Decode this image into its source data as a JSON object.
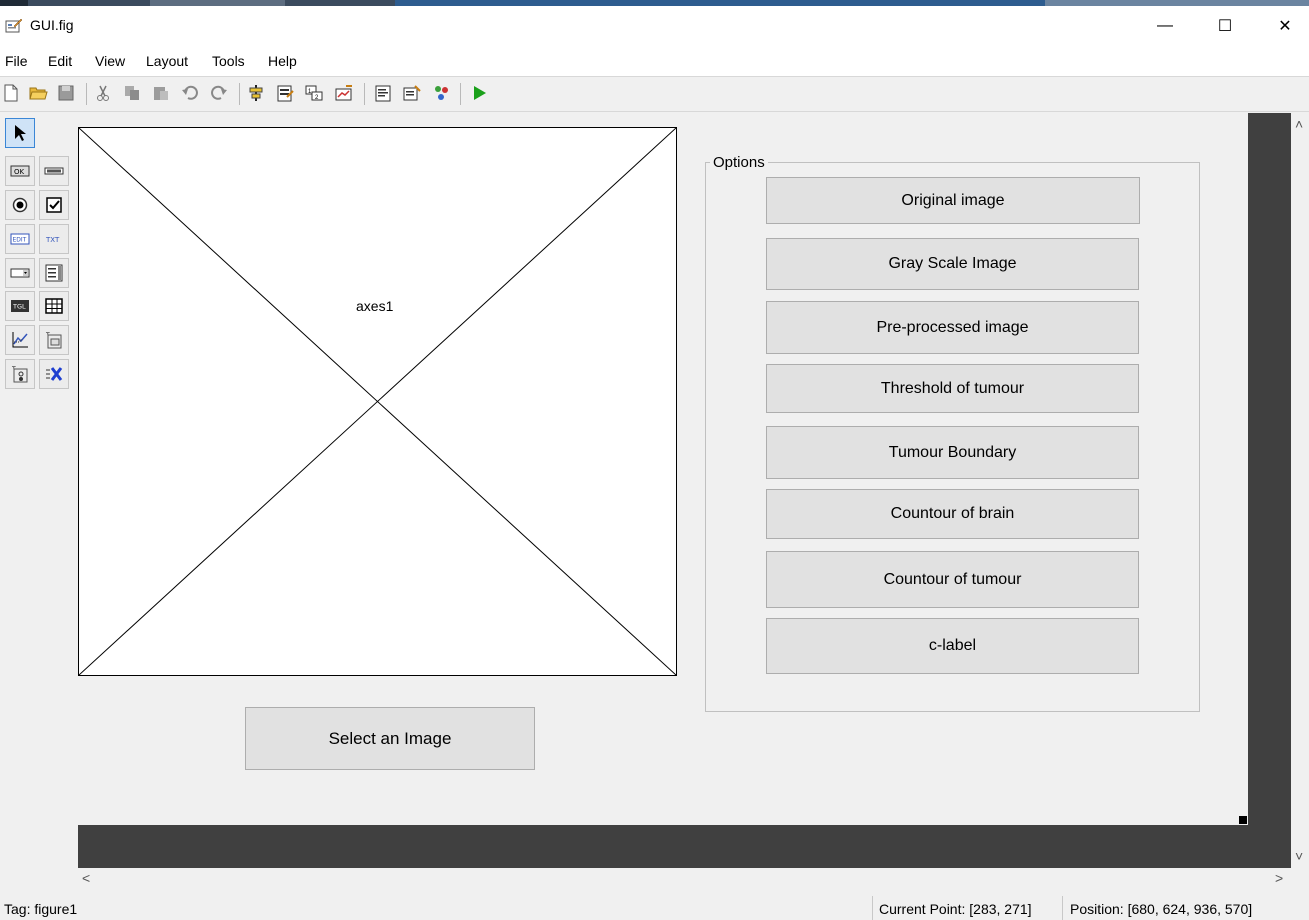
{
  "window": {
    "title": "GUI.fig",
    "minimize_symbol": "—",
    "maximize_symbol": "☐",
    "close_symbol": "✕"
  },
  "menu": [
    "File",
    "Edit",
    "View",
    "Layout",
    "Tools",
    "Help"
  ],
  "toolbar_icons": [
    "new-file-icon",
    "open-folder-icon",
    "save-icon",
    "cut-icon",
    "copy-icon",
    "paste-icon",
    "undo-icon",
    "redo-icon",
    "align-icon",
    "menu-editor-icon",
    "tab-order-icon",
    "toolbar-editor-icon",
    "editor-icon",
    "property-inspector-icon",
    "object-browser-icon",
    "run-icon"
  ],
  "palette_icons": [
    "select-arrow-icon",
    "push-button-icon",
    "slider-icon",
    "radio-button-icon",
    "checkbox-icon",
    "edit-text-icon",
    "static-text-icon",
    "popup-menu-icon",
    "listbox-icon",
    "toggle-button-icon",
    "table-icon",
    "axes-icon",
    "panel-icon",
    "button-group-icon",
    "activex-icon"
  ],
  "palette_labels": {
    "push_button": "OK",
    "edit_text": "EDIT",
    "static_text": "TXT",
    "toggle": "TGL"
  },
  "axes": {
    "label": "axes1"
  },
  "options_panel": {
    "title": "Options",
    "buttons": [
      "Original image",
      "Gray Scale Image",
      "Pre-processed image",
      "Threshold of tumour",
      "Tumour Boundary",
      "Countour of brain",
      "Countour of tumour",
      "c-label"
    ]
  },
  "select_button": "Select an Image",
  "status": {
    "tag": "Tag: figure1",
    "current_point": "Current Point:  [283, 271]",
    "position": "Position: [680, 624, 936, 570]"
  },
  "colors": {
    "window_bg": "#f0f0f0",
    "button_bg": "#e1e1e1",
    "dark_border": "#404040",
    "run_green": "#1aa01a"
  }
}
